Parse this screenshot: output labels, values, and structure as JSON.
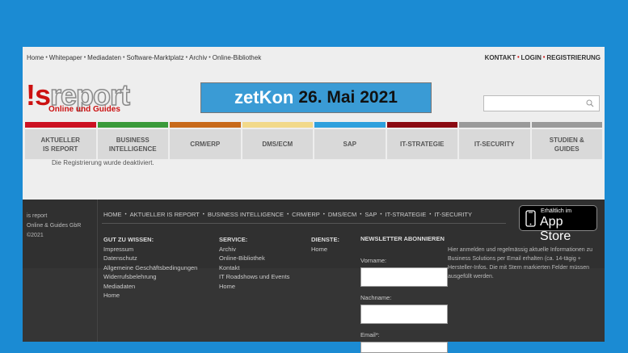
{
  "topbar": {
    "crumbs": [
      "Home",
      "Whitepaper",
      "Mediadaten",
      "Software-Marktplatz",
      "Archiv",
      "Online-Bibliothek"
    ],
    "right": [
      "KONTAKT",
      "LOGIN",
      "REGISTRIERUNG"
    ]
  },
  "logo": {
    "is": "!s",
    "rep": "report",
    "sub": "Online und Guides"
  },
  "banner": {
    "brand": "zetKon",
    "date": "26. Mai 2021"
  },
  "search": {
    "placeholder": ""
  },
  "nav": [
    {
      "label": "AKTUELLER\nIS REPORT",
      "color": "#cc1122"
    },
    {
      "label": "BUSINESS\nINTELLIGENCE",
      "color": "#3a9a3a"
    },
    {
      "label": "CRM/ERP",
      "color": "#c86a1a"
    },
    {
      "label": "DMS/ECM",
      "color": "#f2d98a"
    },
    {
      "label": "SAP",
      "color": "#2ea0dd"
    },
    {
      "label": "IT-STRATEGIE",
      "color": "#8b0a12"
    },
    {
      "label": "IT-SECURITY",
      "color": "#9a9a9a"
    },
    {
      "label": "STUDIEN &\nGUIDES",
      "color": "#9a9a9a"
    }
  ],
  "notice": "Die Registrierung wurde deaktiviert.",
  "footer": {
    "copy": [
      "is report",
      "Online & Guides GbR",
      "©2021"
    ],
    "menu": [
      "HOME",
      "AKTUELLER IS REPORT",
      "BUSINESS INTELLIGENCE",
      "CRM/ERP",
      "DMS/ECM",
      "SAP",
      "IT-STRATEGIE",
      "IT-SECURITY"
    ],
    "appstore": {
      "small": "Erhältlich im",
      "big": "App Store"
    },
    "gut": {
      "heading": "GUT ZU WISSEN:",
      "items": [
        "Impressum",
        "Datenschutz",
        "Allgemeine Geschäftsbedingungen",
        "Widerrufsbelehrung",
        "Mediadaten",
        "Home"
      ]
    },
    "service": {
      "heading": "SERVICE:",
      "items": [
        "Archiv",
        "Online-Bibliothek",
        "Kontakt",
        "IT Roadshows und Events",
        "Home"
      ]
    },
    "dienste": {
      "heading": "DIENSTE:",
      "items": [
        "Home"
      ]
    },
    "newsletter": {
      "heading": "NEWSLETTER ABONNIEREN",
      "vorname": "Vorname:",
      "nachname": "Nachname:",
      "email": "Email*:"
    },
    "desc": "Hier anmelden und regelmässig aktuelle Informationen zu Business Solutions per Email erhalten (ca. 14-tägig + Hersteller-Infos. Die mit Stern markierten Felder müssen ausgefüllt werden."
  }
}
